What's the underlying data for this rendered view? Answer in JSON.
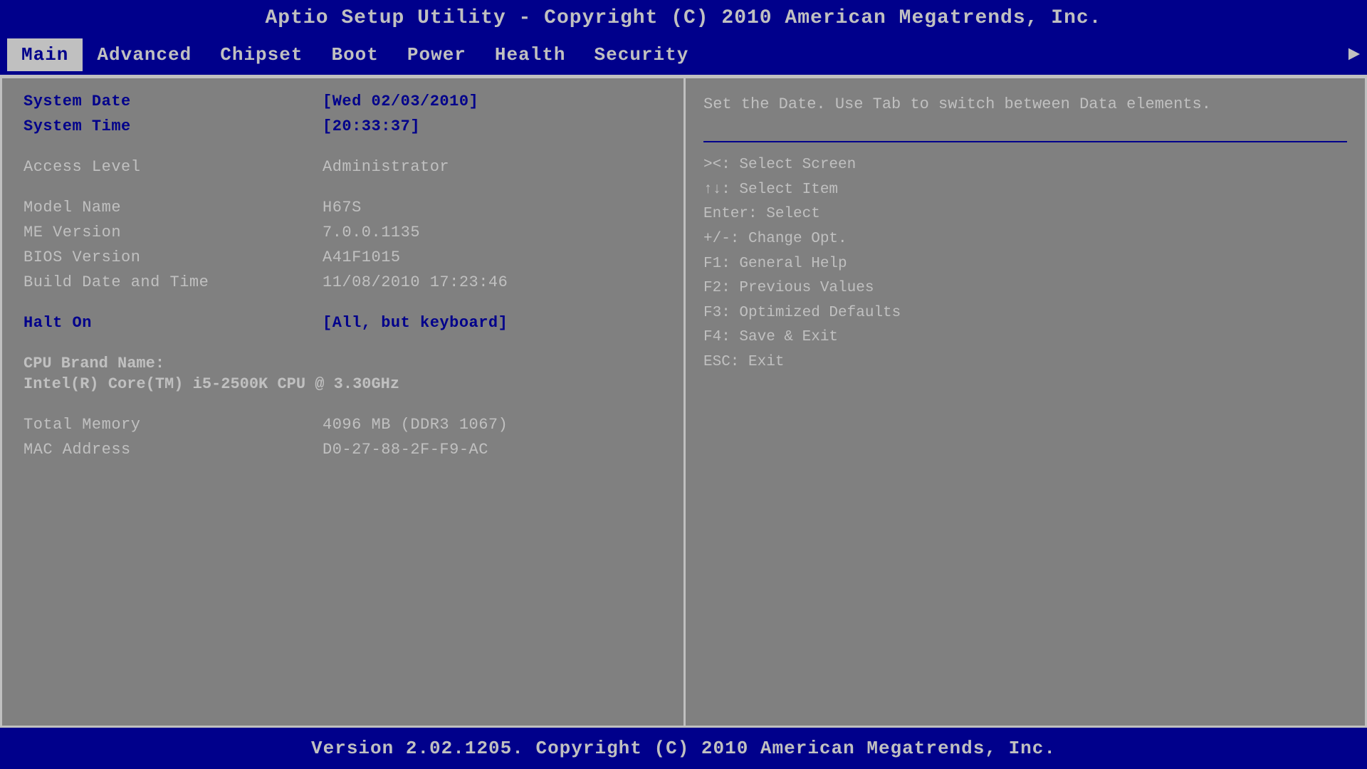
{
  "title": "Aptio Setup Utility - Copyright (C) 2010 American Megatrends, Inc.",
  "nav": {
    "items": [
      {
        "label": "Main",
        "active": true
      },
      {
        "label": "Advanced",
        "active": false
      },
      {
        "label": "Chipset",
        "active": false
      },
      {
        "label": "Boot",
        "active": false
      },
      {
        "label": "Power",
        "active": false
      },
      {
        "label": "Health",
        "active": false
      },
      {
        "label": "Security",
        "active": false
      }
    ],
    "arrow": "►"
  },
  "left": {
    "system_date_label": "System Date",
    "system_date_value": "[Wed 02/03/2010]",
    "system_time_label": "System Time",
    "system_time_value": "[20:33:37]",
    "access_level_label": "Access Level",
    "access_level_value": "Administrator",
    "model_name_label": "Model Name",
    "model_name_value": "H67S",
    "me_version_label": "ME Version",
    "me_version_value": "7.0.0.1135",
    "bios_version_label": "BIOS Version",
    "bios_version_value": "A41F1015",
    "build_date_label": "Build Date and Time",
    "build_date_value": "11/08/2010 17:23:46",
    "halt_on_label": "Halt On",
    "halt_on_value": "[All, but keyboard]",
    "cpu_brand_label": "CPU Brand Name:",
    "cpu_brand_value": "Intel(R) Core(TM) i5-2500K CPU @ 3.30GHz",
    "total_memory_label": "Total Memory",
    "total_memory_value": "4096 MB (DDR3 1067)",
    "mac_address_label": "MAC Address",
    "mac_address_value": "D0-27-88-2F-F9-AC"
  },
  "right": {
    "help_text": "Set the Date. Use Tab\nto switch between Data\nelements.",
    "shortcuts": [
      "><: Select Screen",
      "↑↓: Select Item",
      "Enter: Select",
      "+/-: Change Opt.",
      "F1: General Help",
      "F2: Previous Values",
      "F3: Optimized Defaults",
      "F4: Save & Exit",
      "ESC: Exit"
    ]
  },
  "footer": "Version 2.02.1205. Copyright (C) 2010 American Megatrends, Inc."
}
